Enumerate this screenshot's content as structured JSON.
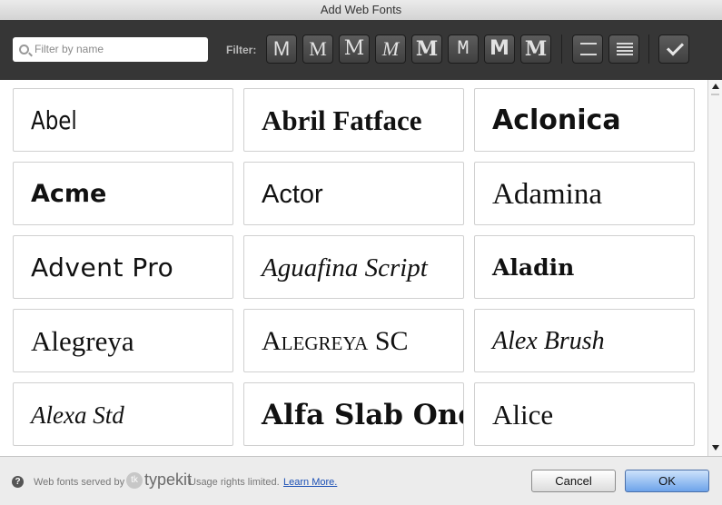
{
  "window": {
    "title": "Add Web Fonts"
  },
  "toolbar": {
    "search": {
      "placeholder": "Filter by name"
    },
    "filter_label": "Filter:",
    "filters": [
      {
        "glyph": "M",
        "name": "sans-serif-filter-icon"
      },
      {
        "glyph": "M",
        "name": "serif-filter-icon"
      },
      {
        "glyph": "M",
        "name": "slab-serif-filter-icon"
      },
      {
        "glyph": "M",
        "name": "script-filter-icon"
      },
      {
        "glyph": "M",
        "name": "blackletter-filter-icon"
      },
      {
        "glyph": "M",
        "name": "monospace-filter-icon"
      },
      {
        "glyph": "M",
        "name": "handwritten-filter-icon"
      },
      {
        "glyph": "M",
        "name": "decorative-filter-icon"
      }
    ],
    "view_buttons": [
      "headings-icon",
      "paragraphs-icon"
    ],
    "selected_button": "checkmark-icon"
  },
  "fonts": [
    {
      "name": "Abel"
    },
    {
      "name": "Abril Fatface"
    },
    {
      "name": "Aclonica"
    },
    {
      "name": "Acme"
    },
    {
      "name": "Actor"
    },
    {
      "name": "Adamina"
    },
    {
      "name": "Advent Pro"
    },
    {
      "name": "Aguafina Script"
    },
    {
      "name": "Aladin"
    },
    {
      "name": "Alegreya"
    },
    {
      "name": "Alegreya SC"
    },
    {
      "name": "Alex Brush"
    },
    {
      "name": "Alexa Std"
    },
    {
      "name": "Alfa Slab One"
    },
    {
      "name": "Alice"
    }
  ],
  "footer": {
    "served_text": "Web fonts served by",
    "typekit_label": "typekit",
    "usage_text": "Usage rights limited.",
    "learn_more": "Learn More.",
    "cancel_label": "Cancel",
    "ok_label": "OK"
  }
}
